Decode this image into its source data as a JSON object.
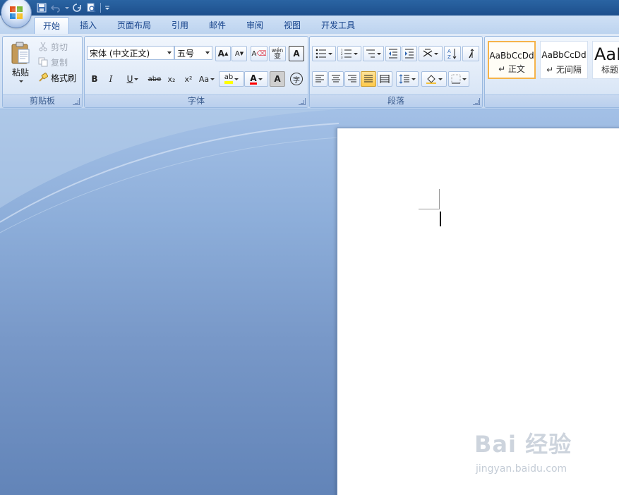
{
  "tabs": [
    {
      "label": "开始",
      "active": true
    },
    {
      "label": "插入",
      "active": false
    },
    {
      "label": "页面布局",
      "active": false
    },
    {
      "label": "引用",
      "active": false
    },
    {
      "label": "邮件",
      "active": false
    },
    {
      "label": "审阅",
      "active": false
    },
    {
      "label": "视图",
      "active": false
    },
    {
      "label": "开发工具",
      "active": false
    }
  ],
  "clipboard": {
    "group_label": "剪贴板",
    "paste_label": "粘贴",
    "cut_label": "剪切",
    "copy_label": "复制",
    "format_painter_label": "格式刷"
  },
  "font": {
    "group_label": "字体",
    "font_name": "宋体 (中文正文)",
    "font_size": "五号",
    "grow_label": "A",
    "shrink_label": "A",
    "clear_label": "A",
    "phonetic_label": "wén",
    "phonetic_char": "变",
    "char_border_label": "A",
    "bold_label": "B",
    "italic_label": "I",
    "underline_label": "U",
    "strike_label": "abe",
    "subscript_label": "x₂",
    "superscript_label": "x²",
    "case_label": "Aa",
    "highlight_label": "ab",
    "font_color_label": "A",
    "char_shading_label": "A",
    "enclose_label": "字"
  },
  "paragraph": {
    "group_label": "段落"
  },
  "styles": {
    "items": [
      {
        "sample": "AaBbCcDd",
        "name": "↵ 正文",
        "selected": true
      },
      {
        "sample": "AaBbCcDd",
        "name": "↵ 无间隔",
        "selected": false
      },
      {
        "sample": "AaB",
        "name": "标题",
        "selected": false
      }
    ]
  },
  "watermark": {
    "logo": "Bai 经验",
    "url": "jingyan.baidu.com"
  },
  "colors": {
    "accent_highlight": "#ffff00",
    "font_color": "#ff0000",
    "title_bar": "#2a64a3"
  }
}
